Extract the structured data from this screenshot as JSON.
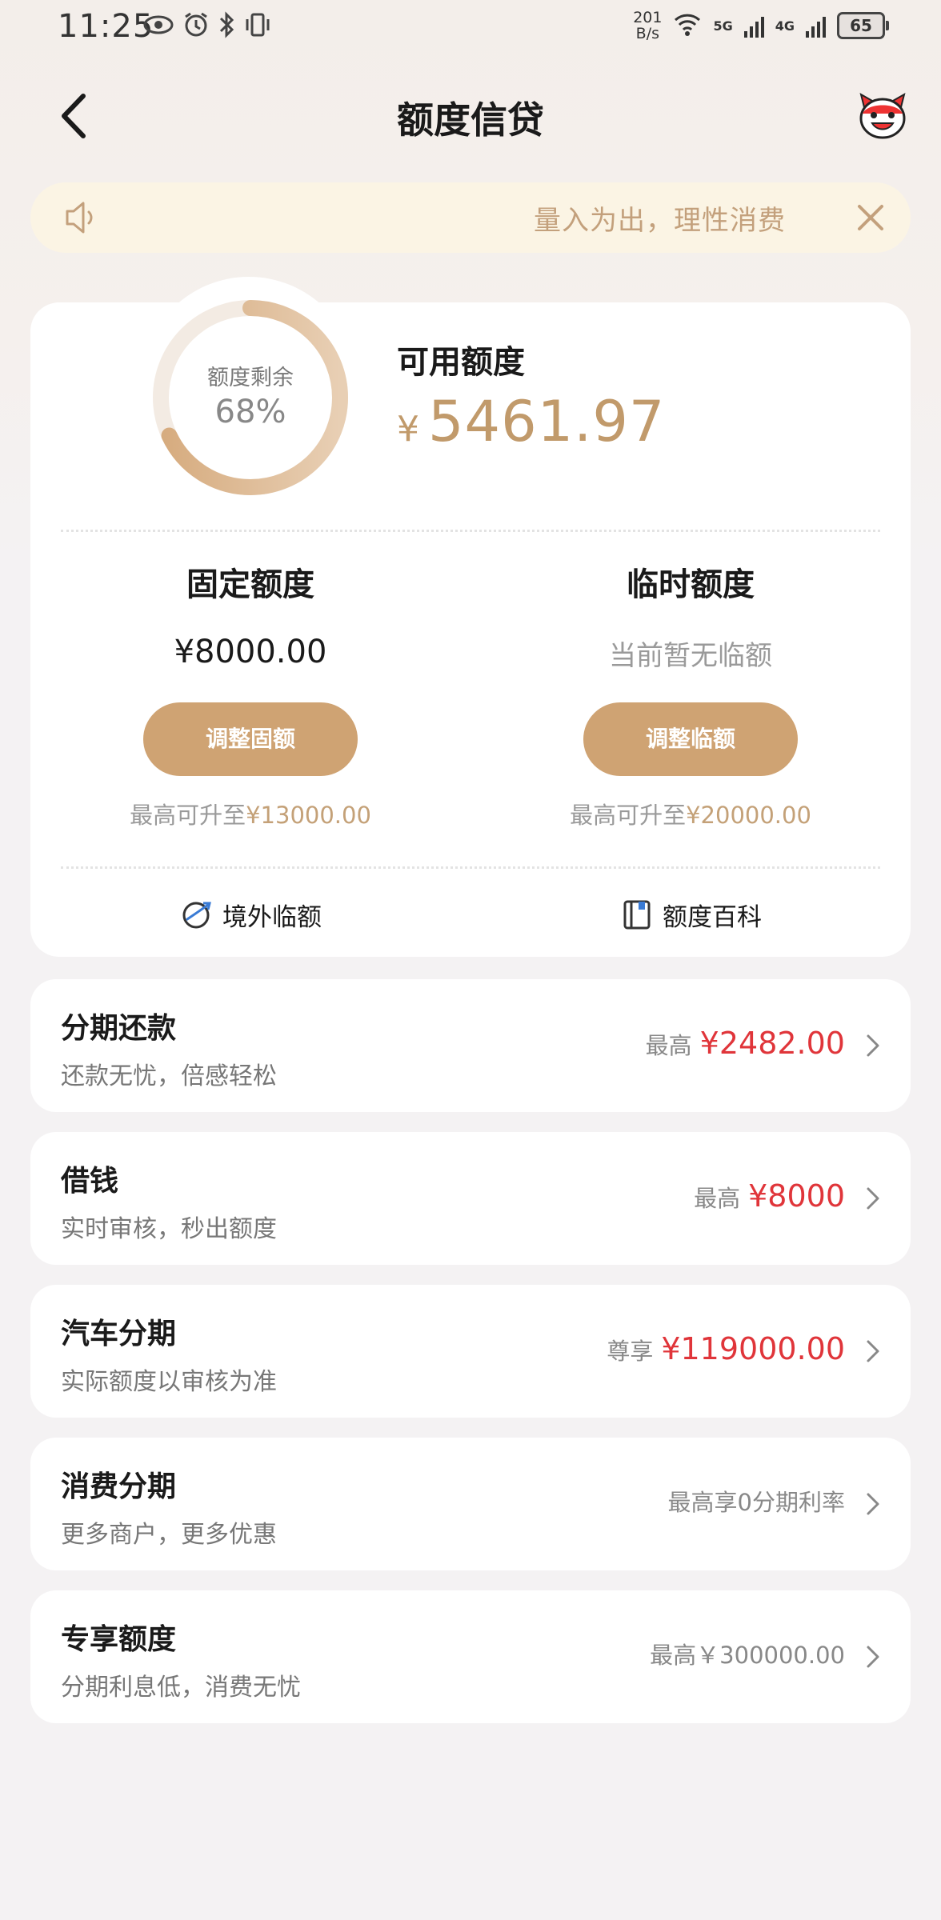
{
  "status_bar": {
    "time": "11:25",
    "speed_value": "201",
    "speed_unit": "B/s",
    "net_1": "5G",
    "net_2": "4G",
    "battery": "65"
  },
  "header": {
    "title": "额度信贷"
  },
  "notice": {
    "text": "量入为出，理性消费"
  },
  "credit": {
    "ring_label": "额度剩余",
    "ring_percent_text": "68%",
    "ring_fraction": 0.68,
    "available_label": "可用额度",
    "available_currency": "¥",
    "available_amount": "5461.97",
    "fixed": {
      "title": "固定额度",
      "amount": "¥8000.00",
      "button": "调整固额",
      "max_prefix": "最高可升至",
      "max_value": "¥13000.00"
    },
    "temporary": {
      "title": "临时额度",
      "note": "当前暂无临额",
      "button": "调整临额",
      "max_prefix": "最高可升至",
      "max_value": "¥20000.00"
    },
    "link_overseas": "境外临额",
    "link_encyclopedia": "额度百科"
  },
  "items": [
    {
      "title": "分期还款",
      "subtitle": "还款无忧，倍感轻松",
      "prefix": "最高",
      "value": "¥2482.00"
    },
    {
      "title": "借钱",
      "subtitle": "实时审核，秒出额度",
      "prefix": "最高",
      "value": "¥8000"
    },
    {
      "title": "汽车分期",
      "subtitle": "实际额度以审核为准",
      "prefix": "尊享",
      "value": "¥119000.00"
    },
    {
      "title": "消费分期",
      "subtitle": "更多商户，更多优惠",
      "prefix": "",
      "value": "最高享0分期利率"
    },
    {
      "title": "专享额度",
      "subtitle": "分期利息低，消费无忧",
      "prefix": "",
      "value": "最高￥300000.00"
    }
  ],
  "colors": {
    "accent_gold": "#cfa373",
    "amount_red": "#e0353a",
    "notice_bg": "#fbf4e4"
  }
}
